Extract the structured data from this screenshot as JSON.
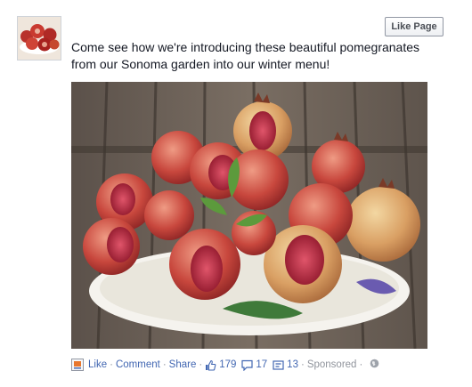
{
  "post": {
    "message": "Come see how we're introducing these beautiful pomegranates from our Sonoma garden into our winter menu!",
    "like_page_label": "Like Page"
  },
  "footer": {
    "like_label": "Like",
    "comment_label": "Comment",
    "share_label": "Share",
    "separator": "·",
    "likes_count": "179",
    "comments_count": "17",
    "shares_count": "13",
    "sponsored_label": "Sponsored"
  },
  "icons": {
    "page_icon": "page-icon",
    "likes": "thumbs-up-icon",
    "comments": "comment-bubble-icon",
    "shares": "share-icon",
    "audience": "globe-icon"
  },
  "colors": {
    "link": "#4267b2",
    "muted": "#90949c",
    "text": "#141823"
  }
}
